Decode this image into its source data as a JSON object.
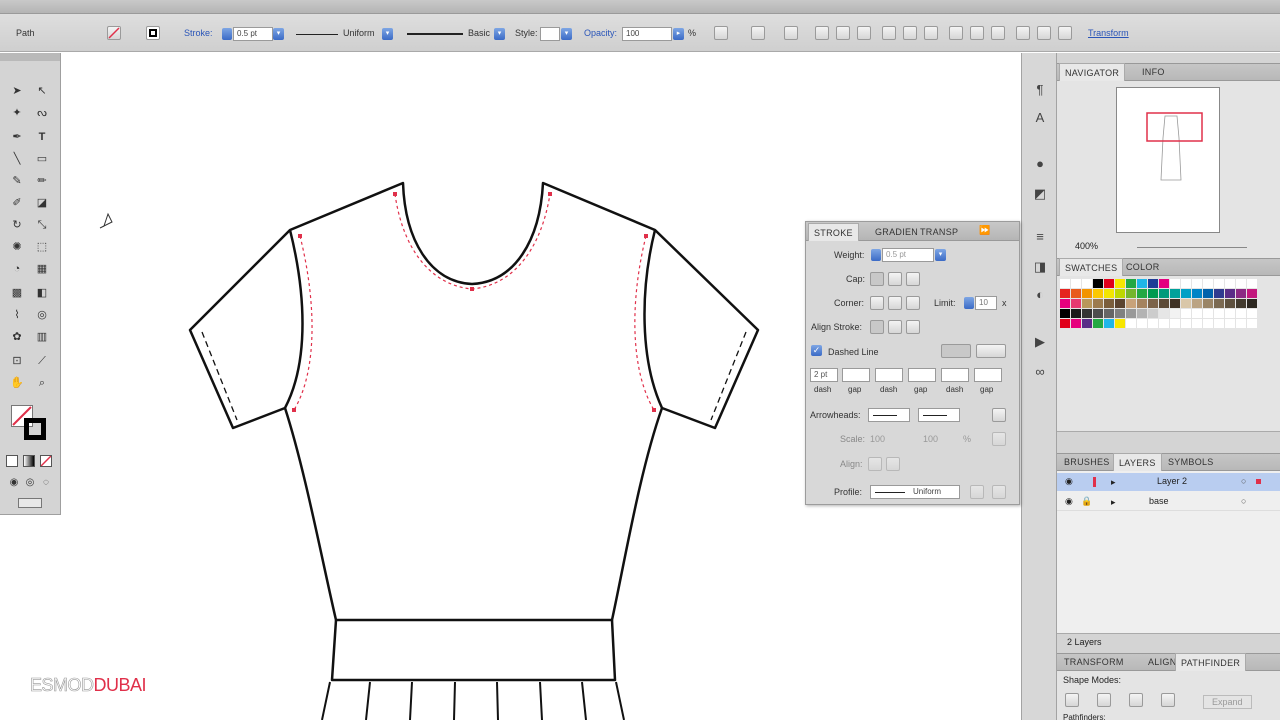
{
  "control_bar": {
    "selection_label": "Path",
    "stroke_label": "Stroke:",
    "stroke_weight": "0.5 pt",
    "profile_value": "Uniform",
    "brush_value": "Basic",
    "style_label": "Style:",
    "opacity_label": "Opacity:",
    "opacity_value": "100",
    "opacity_unit": "%",
    "transform_link": "Transform"
  },
  "navigator": {
    "tabs": [
      "NAVIGATOR",
      "INFO"
    ],
    "zoom": "400%"
  },
  "swatches": {
    "tabs": [
      "SWATCHES",
      "COLOR"
    ]
  },
  "stroke_panel": {
    "tabs": [
      "STROKE",
      "GRADIEN",
      "TRANSP"
    ],
    "weight_label": "Weight:",
    "weight_value": "0.5 pt",
    "cap_label": "Cap:",
    "corner_label": "Corner:",
    "limit_label": "Limit:",
    "limit_value": "10",
    "limit_unit": "x",
    "align_label": "Align Stroke:",
    "dashed_label": "Dashed Line",
    "dash_first": "2 pt",
    "dash_gap_labels": [
      "dash",
      "gap",
      "dash",
      "gap",
      "dash",
      "gap"
    ],
    "arrowheads_label": "Arrowheads:",
    "scale_label": "Scale:",
    "scale_values": [
      "100",
      "100"
    ],
    "scale_unit": "%",
    "align_arrow_label": "Align:",
    "profile_label": "Profile:",
    "profile_value": "Uniform"
  },
  "layers_panel": {
    "tabs": [
      "BRUSHES",
      "LAYERS",
      "SYMBOLS"
    ],
    "layers": [
      "Layer 2",
      "base"
    ],
    "count": "2 Layers",
    "layer_color": "#e0304a"
  },
  "pathfinder_panel": {
    "tabs": [
      "TRANSFORM",
      "ALIGN",
      "PATHFINDER"
    ],
    "shape_modes_label": "Shape Modes:",
    "expand_label": "Expand",
    "pathfinders_label": "Pathfinders:"
  },
  "watermark": {
    "part1": "ESMOD",
    "part2": "DUBAI"
  },
  "colors": {
    "selection_red": "#e0304a",
    "accent_blue": "#3b6bc6",
    "layer_highlight": "#b9cdf0"
  }
}
